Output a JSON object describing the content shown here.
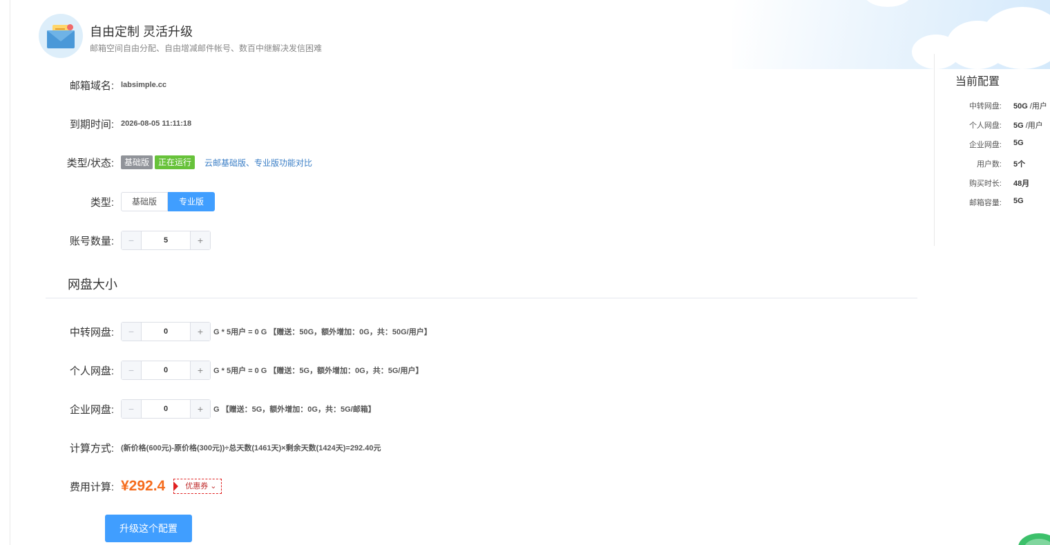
{
  "header": {
    "title": "自由定制 灵活升级",
    "subtitle": "邮箱空间自由分配、自由增减邮件帐号、数百中继解决发信困难"
  },
  "form": {
    "domain": {
      "label": "邮箱域名:",
      "value": "labsimple.cc"
    },
    "expire": {
      "label": "到期时间:",
      "value": "2026-08-05 11:11:18"
    },
    "status": {
      "label": "类型/状态:",
      "type_tag": "基础版",
      "state_tag": "正在运行",
      "compare_link": "云邮基础版、专业版功能对比"
    },
    "type": {
      "label": "类型:",
      "options": [
        "基础版",
        "专业版"
      ],
      "selected": "专业版"
    },
    "accounts": {
      "label": "账号数量:",
      "value": "5",
      "minus": "−",
      "plus": "+"
    }
  },
  "disk_section": {
    "title": "网盘大小"
  },
  "disks": {
    "transfer": {
      "label": "中转网盘:",
      "value": "0",
      "formula": "G * 5用户 = 0 G 【赠送：50G，额外增加：0G，共：50G/用户】"
    },
    "personal": {
      "label": "个人网盘:",
      "value": "0",
      "formula": "G * 5用户 = 0 G 【赠送：5G，额外增加：0G，共：5G/用户】"
    },
    "enterprise": {
      "label": "企业网盘:",
      "value": "0",
      "formula": "G 【赠送：5G，额外增加：0G，共：5G/邮箱】"
    }
  },
  "calc": {
    "label": "计算方式:",
    "value": "(新价格(600元)-原价格(300元))÷总天数(1461天)×剩余天数(1424天)=292.40元"
  },
  "cost": {
    "label": "费用计算:",
    "price": "¥292.4",
    "coupon": "优惠券 ⌄"
  },
  "submit_label": "升级这个配置",
  "current_config": {
    "title": "当前配置",
    "rows": [
      {
        "key": "中转网盘:",
        "value": "50G",
        "suffix": " /用户"
      },
      {
        "key": "个人网盘:",
        "value": "5G",
        "suffix": " /用户"
      },
      {
        "key": "企业网盘:",
        "value": "5G",
        "suffix": ""
      },
      {
        "key": "用户数:",
        "value": "5个",
        "suffix": ""
      },
      {
        "key": "购买时长:",
        "value": "48月",
        "suffix": ""
      },
      {
        "key": "邮箱容量:",
        "value": "5G",
        "suffix": ""
      }
    ]
  },
  "colors": {
    "primary": "#409eff",
    "price": "#f56c1d",
    "tag_gray": "#909399",
    "tag_green": "#67c23a"
  }
}
